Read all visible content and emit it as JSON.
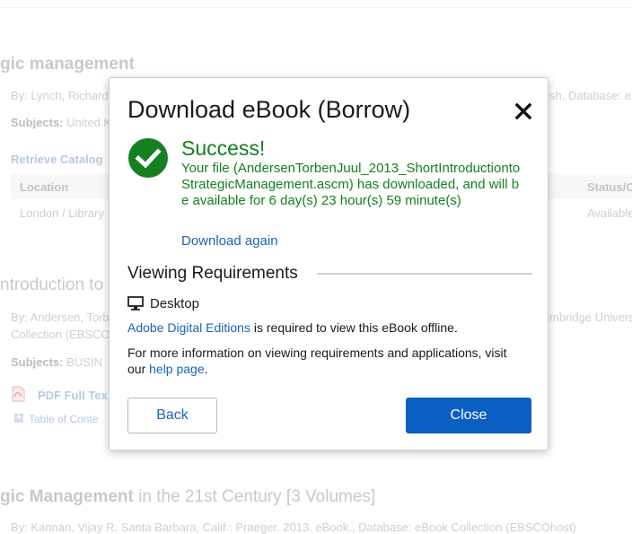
{
  "background": {
    "result1": {
      "title": "gic management",
      "byline": "By: Lynch, Richard",
      "database_fragment": "sh, Database: e",
      "subjects_label": "Subjects:",
      "subjects_value": "United K",
      "retrieve_link": "Retrieve Catalog",
      "table_headers": [
        "Location",
        "Status/C"
      ],
      "table_row": [
        "London / Library",
        "Available"
      ]
    },
    "result2": {
      "title": "ntroduction to",
      "byline": "By: Andersen, Torb",
      "publisher_fragment": "mbridge Univers",
      "collection": "Collection (EBSCO",
      "subjects_label": "Subjects:",
      "subjects_value": "BUSIN",
      "pdf_link": "PDF Full Tex",
      "toc_link": "Table of Conte"
    },
    "result3": {
      "title_bold": "gic Management",
      "title_rest": " in the 21st Century [3 Volumes]",
      "byline": "By: Kannan, Vijay R. Santa Barbara, Calif.: Praeger. 2013. eBook., Database: eBook Collection (EBSCOhost)"
    }
  },
  "modal": {
    "title": "Download eBook (Borrow)",
    "close_icon": "close-icon",
    "success_icon": "check-circle-icon",
    "success_heading": "Success!",
    "success_message": "Your file (AndersenTorbenJuul_2013_ShortIntroductiontoStrategicManagement.ascm) has downloaded, and will be available for 6 day(s) 23 hour(s) 59 minute(s)",
    "download_again": "Download again",
    "viewing_requirements_heading": "Viewing Requirements",
    "desktop_icon": "desktop-icon",
    "desktop_label": "Desktop",
    "adobe_link": "Adobe Digital Editions",
    "adobe_text": " is required to view this eBook offline.",
    "info_text": "For more information on viewing requirements and applications, visit our ",
    "help_link": "help page",
    "info_end": ".",
    "back_button": "Back",
    "close_button": "Close"
  },
  "colors": {
    "success_green": "#148022",
    "link_blue": "#1b63b5",
    "primary_button": "#0b5ec4"
  }
}
